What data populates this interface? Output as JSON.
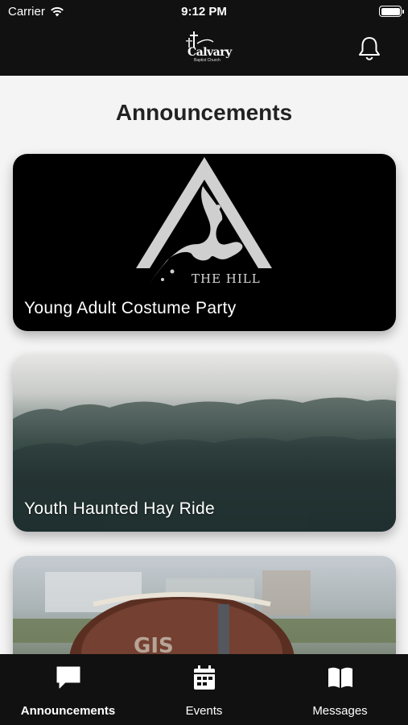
{
  "status_bar": {
    "carrier": "Carrier",
    "time": "9:12 PM"
  },
  "header": {
    "logo_word": "Calvary",
    "logo_sub": "Baptist Church",
    "bell_icon": "bell-icon"
  },
  "main": {
    "title": "Announcements",
    "cards": [
      {
        "label": "Young Adult Costume Party",
        "image_text": "THE HILL"
      },
      {
        "label": "Youth Haunted Hay Ride"
      },
      {
        "label": ""
      }
    ]
  },
  "tabbar": {
    "tabs": [
      {
        "label": "Announcements",
        "icon": "chat-bubble-icon",
        "active": true
      },
      {
        "label": "Events",
        "icon": "calendar-icon",
        "active": false
      },
      {
        "label": "Messages",
        "icon": "book-icon",
        "active": false
      }
    ]
  },
  "colors": {
    "bar": "#111111",
    "background": "#f4f4f4",
    "text": "#222222"
  }
}
